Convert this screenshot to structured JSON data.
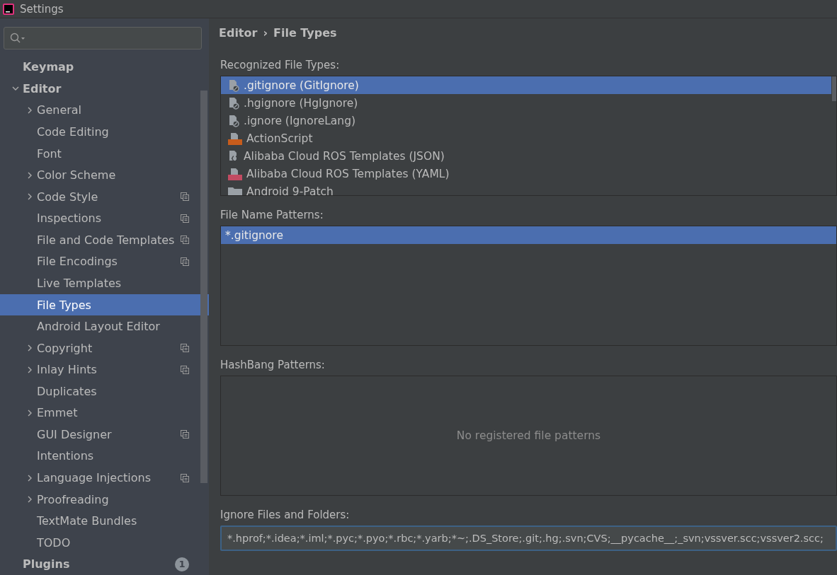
{
  "window": {
    "title": "Settings"
  },
  "sidebar": {
    "items": [
      {
        "label": "Keymap",
        "selected": false,
        "kind": "page"
      },
      {
        "label": "Editor",
        "selected": false,
        "kind": "group",
        "expanded": true,
        "children": [
          {
            "label": "General",
            "selected": false,
            "kind": "group",
            "expanded": false,
            "project_level": false
          },
          {
            "label": "Code Editing",
            "selected": false,
            "kind": "page",
            "project_level": false
          },
          {
            "label": "Font",
            "selected": false,
            "kind": "page",
            "project_level": false
          },
          {
            "label": "Color Scheme",
            "selected": false,
            "kind": "group",
            "expanded": false,
            "project_level": false
          },
          {
            "label": "Code Style",
            "selected": false,
            "kind": "group",
            "expanded": false,
            "project_level": true
          },
          {
            "label": "Inspections",
            "selected": false,
            "kind": "page",
            "project_level": true
          },
          {
            "label": "File and Code Templates",
            "selected": false,
            "kind": "page",
            "project_level": true
          },
          {
            "label": "File Encodings",
            "selected": false,
            "kind": "page",
            "project_level": true
          },
          {
            "label": "Live Templates",
            "selected": false,
            "kind": "page",
            "project_level": false
          },
          {
            "label": "File Types",
            "selected": true,
            "kind": "page",
            "project_level": false
          },
          {
            "label": "Android Layout Editor",
            "selected": false,
            "kind": "page",
            "project_level": false
          },
          {
            "label": "Copyright",
            "selected": false,
            "kind": "group",
            "expanded": false,
            "project_level": true
          },
          {
            "label": "Inlay Hints",
            "selected": false,
            "kind": "group",
            "expanded": false,
            "project_level": true
          },
          {
            "label": "Duplicates",
            "selected": false,
            "kind": "page",
            "project_level": false
          },
          {
            "label": "Emmet",
            "selected": false,
            "kind": "group",
            "expanded": false,
            "project_level": false
          },
          {
            "label": "GUI Designer",
            "selected": false,
            "kind": "page",
            "project_level": true
          },
          {
            "label": "Intentions",
            "selected": false,
            "kind": "page",
            "project_level": false
          },
          {
            "label": "Language Injections",
            "selected": false,
            "kind": "group",
            "expanded": false,
            "project_level": true
          },
          {
            "label": "Proofreading",
            "selected": false,
            "kind": "group",
            "expanded": false,
            "project_level": false
          },
          {
            "label": "TextMate Bundles",
            "selected": false,
            "kind": "page",
            "project_level": false
          },
          {
            "label": "TODO",
            "selected": false,
            "kind": "page",
            "project_level": false
          }
        ]
      },
      {
        "label": "Plugins",
        "selected": false,
        "kind": "page",
        "badge": "1"
      }
    ]
  },
  "breadcrumb": [
    "Editor",
    "File Types"
  ],
  "breadcrumb_separator": "›",
  "recognized": {
    "label": "Recognized File Types:",
    "items": [
      {
        "label": ".gitignore (GitIgnore)",
        "kind": "ignore",
        "selected": true
      },
      {
        "label": ".hgignore (HgIgnore)",
        "kind": "ignore",
        "selected": false
      },
      {
        "label": ".ignore (IgnoreLang)",
        "kind": "ignore",
        "selected": false
      },
      {
        "label": "ActionScript",
        "kind": "actionscript",
        "selected": false
      },
      {
        "label": "Alibaba Cloud ROS Templates (JSON)",
        "kind": "json",
        "selected": false
      },
      {
        "label": "Alibaba Cloud ROS Templates (YAML)",
        "kind": "yaml",
        "selected": false
      },
      {
        "label": "Android 9-Patch",
        "kind": "folder",
        "selected": false
      }
    ]
  },
  "patterns": {
    "label": "File Name Patterns:",
    "items": [
      {
        "label": "*.gitignore",
        "selected": true
      }
    ]
  },
  "hashbang": {
    "label": "HashBang Patterns:",
    "empty_text": "No registered file patterns"
  },
  "ignore": {
    "label": "Ignore Files and Folders:",
    "value": "*.hprof;*.idea;*.iml;*.pyc;*.pyo;*.rbc;*.yarb;*~;.DS_Store;.git;.hg;.svn;CVS;__pycache__;_svn;vssver.scc;vssver2.scc;"
  }
}
